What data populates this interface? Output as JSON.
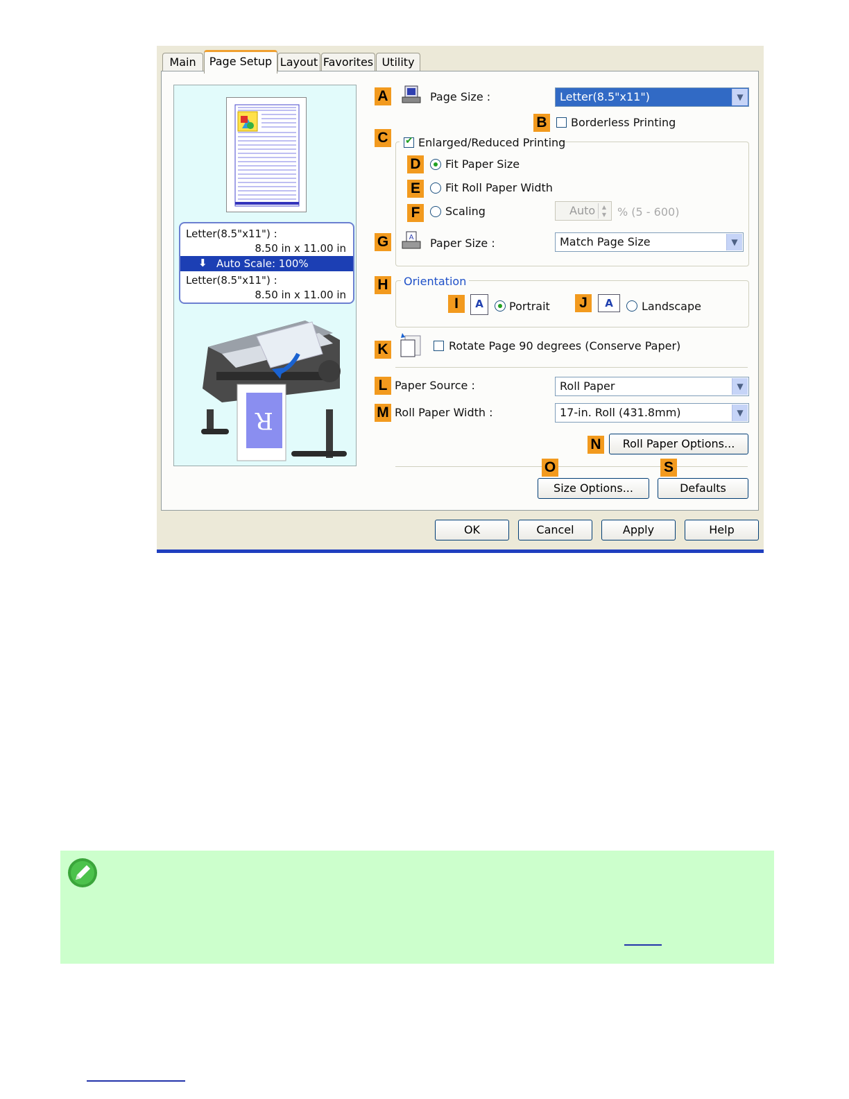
{
  "tabs": [
    "Main",
    "Page Setup",
    "Layout",
    "Favorites",
    "Utility"
  ],
  "active_tab": "Page Setup",
  "preview": {
    "source_size": "Letter(8.5\"x11\") :",
    "source_dims": "8.50 in x 11.00 in",
    "scale_label": "Auto Scale: 100%",
    "output_size": "Letter(8.5\"x11\") :",
    "output_dims": "8.50 in x 11.00 in"
  },
  "markers": {
    "A": "A",
    "B": "B",
    "C": "C",
    "D": "D",
    "E": "E",
    "F": "F",
    "G": "G",
    "H": "H",
    "I": "I",
    "J": "J",
    "K": "K",
    "L": "L",
    "M": "M",
    "N": "N",
    "O": "O",
    "S": "S"
  },
  "page_size": {
    "label": "Page Size :",
    "value": "Letter(8.5\"x11\")"
  },
  "borderless": {
    "label": "Borderless Printing",
    "checked": false
  },
  "enlarged": {
    "label": "Enlarged/Reduced Printing",
    "checked": true,
    "fit_paper": "Fit Paper Size",
    "fit_roll": "Fit Roll Paper Width",
    "scaling": "Scaling",
    "scaling_value": "Auto",
    "scaling_range": "% (5 - 600)",
    "selected": "Fit Paper Size"
  },
  "paper_size": {
    "label": "Paper Size :",
    "value": "Match Page Size"
  },
  "orientation": {
    "label": "Orientation",
    "portrait": "Portrait",
    "landscape": "Landscape",
    "icon_letter": "A",
    "selected": "Portrait"
  },
  "rotate": {
    "label": "Rotate Page 90 degrees (Conserve Paper)",
    "checked": false
  },
  "paper_source": {
    "label": "Paper Source :",
    "value": "Roll Paper"
  },
  "roll_width": {
    "label": "Roll Paper Width :",
    "value": "17-in. Roll (431.8mm)"
  },
  "buttons": {
    "roll_options": "Roll Paper Options...",
    "size_options": "Size Options...",
    "defaults": "Defaults",
    "ok": "OK",
    "cancel": "Cancel",
    "apply": "Apply",
    "help": "Help"
  },
  "colors": {
    "marker": "#f29a1e",
    "note_bg": "#ccffcc",
    "accent_blue": "#1f3fbf",
    "selection": "#316ac5"
  }
}
